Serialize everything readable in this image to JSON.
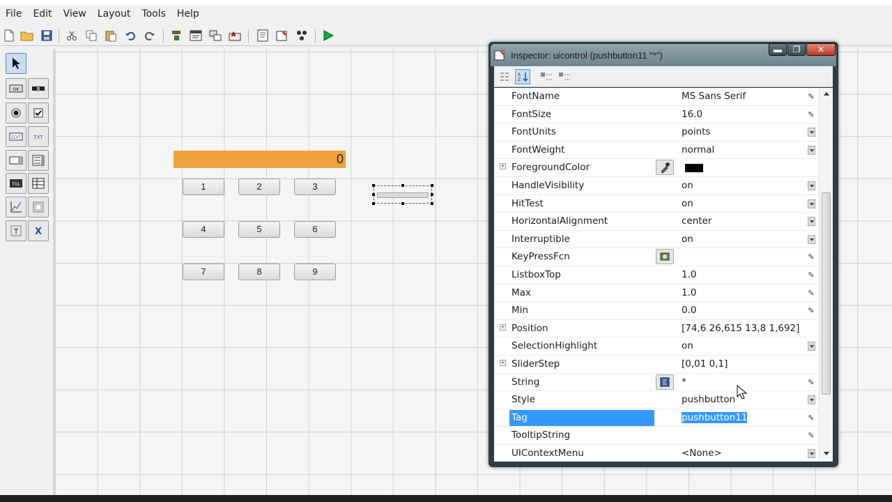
{
  "menubar": {
    "items": [
      "File",
      "Edit",
      "View",
      "Layout",
      "Tools",
      "Help"
    ]
  },
  "toolbar": {
    "icons": [
      "new-file-icon",
      "open-folder-icon",
      "save-icon",
      "cut-icon",
      "copy-icon",
      "paste-icon",
      "undo-icon",
      "redo-icon",
      "align-objects-icon",
      "menu-editor-icon",
      "tab-order-editor-icon",
      "toolbar-editor-icon",
      "editor-icon",
      "property-inspector-icon",
      "object-browser-icon",
      "run-figure-icon"
    ]
  },
  "palette": {
    "tools": [
      "select-tool",
      "push-button-tool",
      "slider-tool",
      "radio-button-tool",
      "checkbox-tool",
      "edit-text-tool",
      "static-text-tool",
      "popup-menu-tool",
      "listbox-tool",
      "toggle-button-tool",
      "table-tool",
      "axes-tool",
      "panel-tool",
      "button-group-tool",
      "activex-control-tool"
    ]
  },
  "canvas": {
    "display_value": "0",
    "keys": [
      "1",
      "2",
      "3",
      "4",
      "5",
      "6",
      "7",
      "8",
      "9"
    ]
  },
  "inspector": {
    "title": "Inspector:  uicontrol (pushbutton11 \"*\")",
    "window_buttons": {
      "minimize": "▬",
      "maximize": "❐",
      "close": "✕"
    },
    "properties": [
      {
        "name": "FontName",
        "value": "MS Sans Serif",
        "control": "edit",
        "expander": false
      },
      {
        "name": "FontSize",
        "value": "16.0",
        "control": "edit",
        "expander": false
      },
      {
        "name": "FontUnits",
        "value": "points",
        "control": "drop",
        "expander": false
      },
      {
        "name": "FontWeight",
        "value": "normal",
        "control": "drop",
        "expander": false
      },
      {
        "name": "ForegroundColor",
        "value": "",
        "control": "color",
        "expander": true
      },
      {
        "name": "HandleVisibility",
        "value": "on",
        "control": "drop",
        "expander": false
      },
      {
        "name": "HitTest",
        "value": "on",
        "control": "drop",
        "expander": false
      },
      {
        "name": "HorizontalAlignment",
        "value": "center",
        "control": "drop",
        "expander": false
      },
      {
        "name": "Interruptible",
        "value": "on",
        "control": "drop",
        "expander": false
      },
      {
        "name": "KeyPressFcn",
        "value": "",
        "control": "callback",
        "expander": false
      },
      {
        "name": "ListboxTop",
        "value": "1.0",
        "control": "edit",
        "expander": false
      },
      {
        "name": "Max",
        "value": "1.0",
        "control": "edit",
        "expander": false
      },
      {
        "name": "Min",
        "value": "0.0",
        "control": "edit",
        "expander": false
      },
      {
        "name": "Position",
        "value": "[74,6 26,615 13,8 1,692]",
        "control": "none",
        "expander": true
      },
      {
        "name": "SelectionHighlight",
        "value": "on",
        "control": "drop",
        "expander": false
      },
      {
        "name": "SliderStep",
        "value": "[0,01 0,1]",
        "control": "none",
        "expander": true
      },
      {
        "name": "String",
        "value": "*",
        "control": "string",
        "expander": false
      },
      {
        "name": "Style",
        "value": "pushbutton",
        "control": "drop",
        "expander": false
      },
      {
        "name": "Tag",
        "value": "pushbutton11",
        "control": "edit",
        "expander": false,
        "selected": true
      },
      {
        "name": "TooltipString",
        "value": "",
        "control": "edit",
        "expander": false
      },
      {
        "name": "UIContextMenu",
        "value": "<None>",
        "control": "drop",
        "expander": false
      }
    ]
  },
  "colors": {
    "display_bg": "#f2a23c",
    "selection": "#3399ff"
  }
}
